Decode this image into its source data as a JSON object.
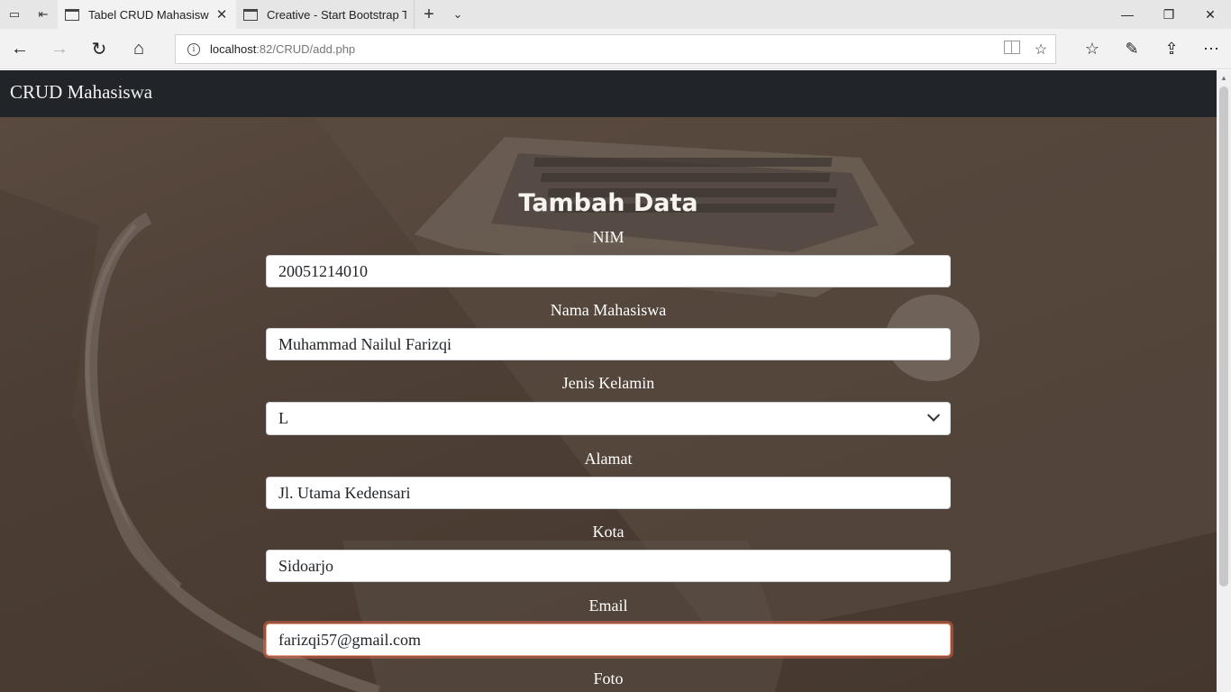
{
  "browser": {
    "tabs": [
      {
        "title": "Tabel CRUD Mahasiswa",
        "active": true
      },
      {
        "title": "Creative - Start Bootstrap Tl",
        "active": false
      }
    ],
    "url": {
      "host": "localhost",
      "port_path": ":82/CRUD/add.php"
    }
  },
  "navbar": {
    "brand": "CRUD Mahasiswa"
  },
  "form": {
    "title": "Tambah Data",
    "nim": {
      "label": "NIM",
      "value": "20051214010"
    },
    "nama": {
      "label": "Nama Mahasiswa",
      "value": "Muhammad Nailul Farizqi"
    },
    "jenis_kelamin": {
      "label": "Jenis Kelamin",
      "value": "L"
    },
    "alamat": {
      "label": "Alamat",
      "value": "Jl. Utama Kedensari"
    },
    "kota": {
      "label": "Kota",
      "value": "Sidoarjo"
    },
    "email": {
      "label": "Email",
      "value": "farizqi57@gmail.com"
    },
    "foto": {
      "label": "Foto"
    }
  }
}
